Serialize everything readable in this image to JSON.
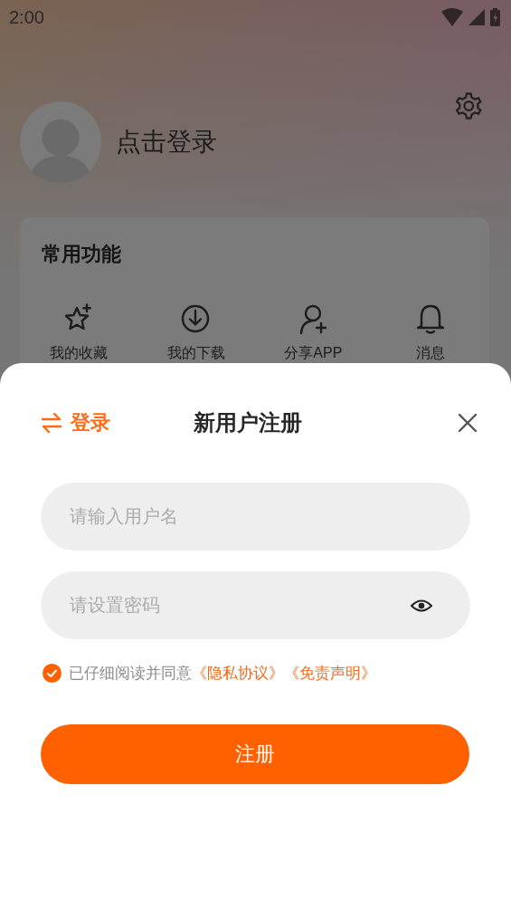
{
  "status_bar": {
    "time": "2:00"
  },
  "profile": {
    "login_prompt": "点击登录"
  },
  "features": {
    "title": "常用功能",
    "items": [
      {
        "kind": "star",
        "label": "我的收藏"
      },
      {
        "kind": "download",
        "label": "我的下载"
      },
      {
        "kind": "share",
        "label": "分享APP"
      },
      {
        "kind": "bell",
        "label": "消息"
      }
    ]
  },
  "register_sheet": {
    "switch_link": "登录",
    "title": "新用户注册",
    "fields": [
      {
        "kind": "text",
        "placeholder": "请输入用户名"
      },
      {
        "kind": "password",
        "placeholder": "请设置密码"
      }
    ],
    "agreement": {
      "checked": true,
      "text": "已仔细阅读并同意",
      "links": [
        "《隐私协议》",
        "《免责声明》"
      ]
    },
    "submit": "注册"
  }
}
